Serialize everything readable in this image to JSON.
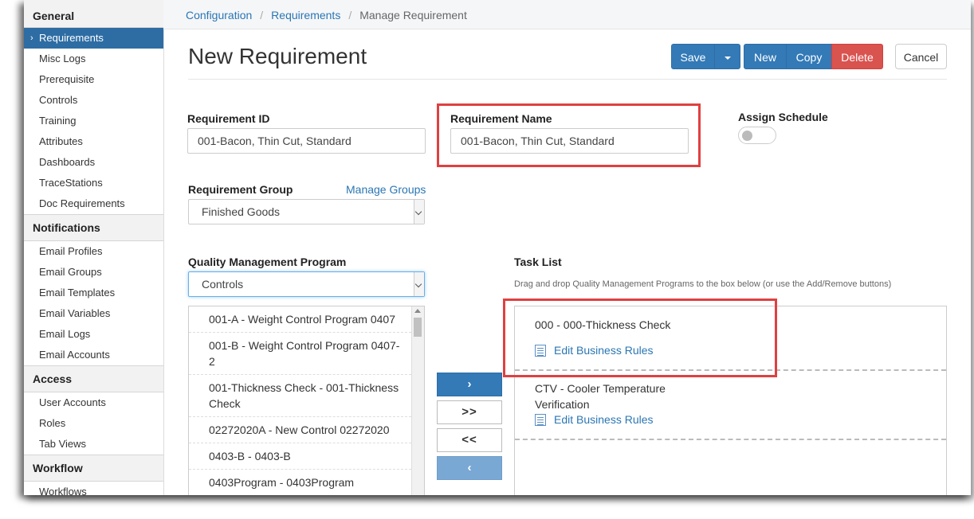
{
  "sidebar": {
    "sections": [
      {
        "title": "General",
        "items": [
          "Requirements",
          "Misc Logs",
          "Prerequisite",
          "Controls",
          "Training",
          "Attributes",
          "Dashboards",
          "TraceStations",
          "Doc Requirements"
        ]
      },
      {
        "title": "Notifications",
        "items": [
          "Email Profiles",
          "Email Groups",
          "Email Templates",
          "Email Variables",
          "Email Logs",
          "Email Accounts"
        ]
      },
      {
        "title": "Access",
        "items": [
          "User Accounts",
          "Roles",
          "Tab Views"
        ]
      },
      {
        "title": "Workflow",
        "items": [
          "Workflows"
        ]
      }
    ],
    "active_item": "Requirements"
  },
  "breadcrumb": {
    "items": [
      "Configuration",
      "Requirements"
    ],
    "current": "Manage Requirement"
  },
  "page_title": "New Requirement",
  "toolbar": {
    "save": "Save",
    "new": "New",
    "copy": "Copy",
    "delete": "Delete",
    "cancel": "Cancel"
  },
  "form": {
    "requirement_id": {
      "label": "Requirement ID",
      "value": "001-Bacon, Thin Cut, Standard"
    },
    "requirement_name": {
      "label": "Requirement Name",
      "value": "001-Bacon, Thin Cut, Standard"
    },
    "assign_schedule": {
      "label": "Assign Schedule",
      "on": false
    },
    "requirement_group": {
      "label": "Requirement Group",
      "manage_link": "Manage Groups",
      "value": "Finished Goods"
    },
    "qmp": {
      "label": "Quality Management Program",
      "value": "Controls"
    }
  },
  "program_list": [
    "001-A - Weight Control Program 0407",
    "001-B - Weight Control Program 0407-2",
    "001-Thickness Check - 001-Thickness Check",
    "02272020A - New Control 02272020",
    "0403-B - 0403-B",
    "0403Program - 0403Program"
  ],
  "move_buttons": {
    "add": "›",
    "add_all": ">>",
    "remove_all": "<<",
    "remove": "‹"
  },
  "task_list": {
    "label": "Task List",
    "helper": "Drag and drop Quality Management Programs to the box below (or use the Add/Remove buttons)",
    "tasks": [
      {
        "name": "000 - 000-Thickness Check",
        "rules_link": "Edit Business Rules"
      },
      {
        "name": "CTV - Cooler Temperature Verification",
        "rules_link": "Edit Business Rules"
      }
    ]
  },
  "colors": {
    "primary": "#337ab7",
    "danger": "#d9534f",
    "highlight": "#e04040",
    "link": "#2a76b3"
  }
}
